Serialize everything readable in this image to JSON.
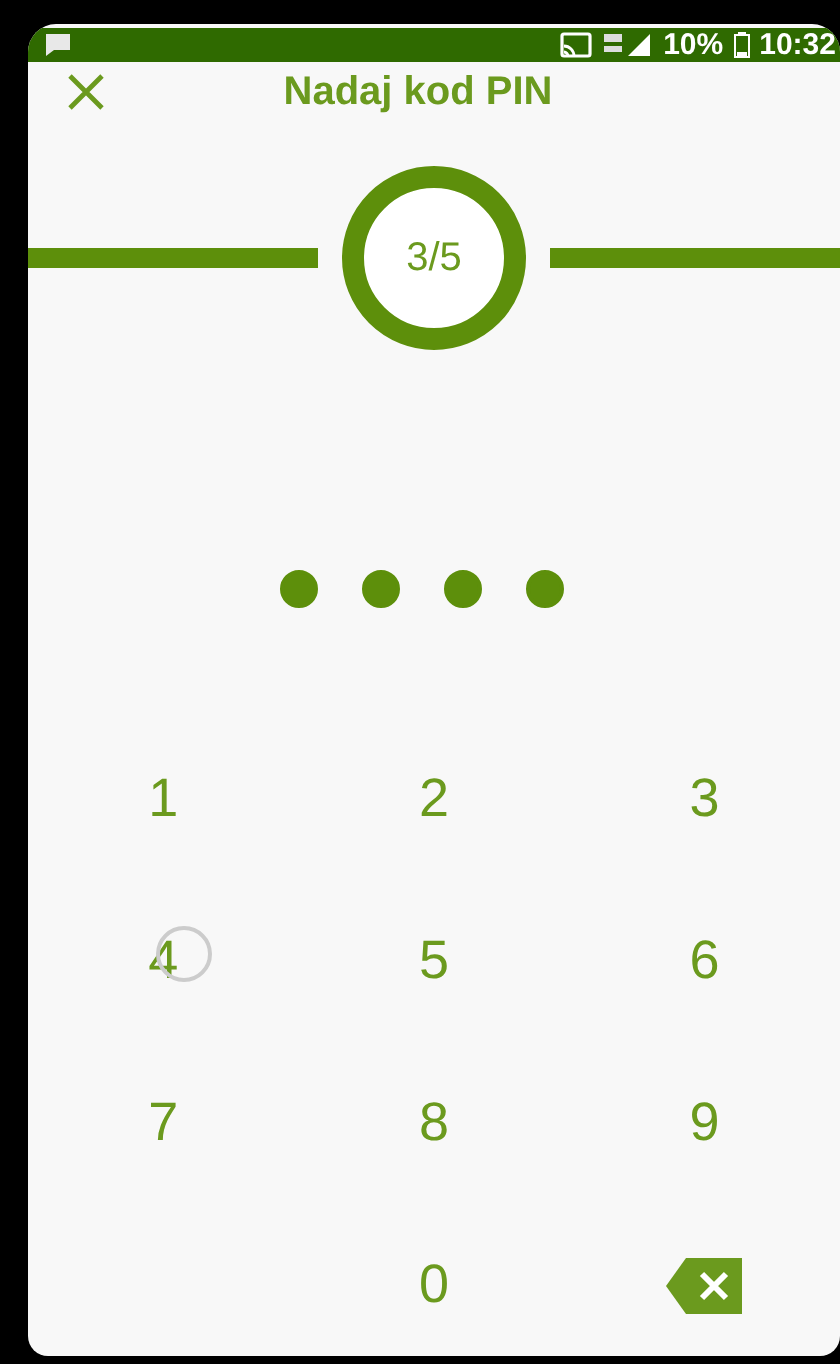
{
  "status_bar": {
    "battery": "10%",
    "time": "10:32"
  },
  "header": {
    "title": "Nadaj kod PIN"
  },
  "progress": {
    "step": "3/5"
  },
  "pin_dots": [
    {
      "filled": true
    },
    {
      "filled": true
    },
    {
      "filled": true
    },
    {
      "filled": true
    }
  ],
  "keypad": [
    {
      "kind": "digit",
      "label": "1",
      "pressed": false
    },
    {
      "kind": "digit",
      "label": "2",
      "pressed": false
    },
    {
      "kind": "digit",
      "label": "3",
      "pressed": false
    },
    {
      "kind": "digit",
      "label": "4",
      "pressed": true
    },
    {
      "kind": "digit",
      "label": "5",
      "pressed": false
    },
    {
      "kind": "digit",
      "label": "6",
      "pressed": false
    },
    {
      "kind": "digit",
      "label": "7",
      "pressed": false
    },
    {
      "kind": "digit",
      "label": "8",
      "pressed": false
    },
    {
      "kind": "digit",
      "label": "9",
      "pressed": false
    },
    {
      "kind": "blank"
    },
    {
      "kind": "digit",
      "label": "0",
      "pressed": false
    },
    {
      "kind": "backspace"
    }
  ]
}
